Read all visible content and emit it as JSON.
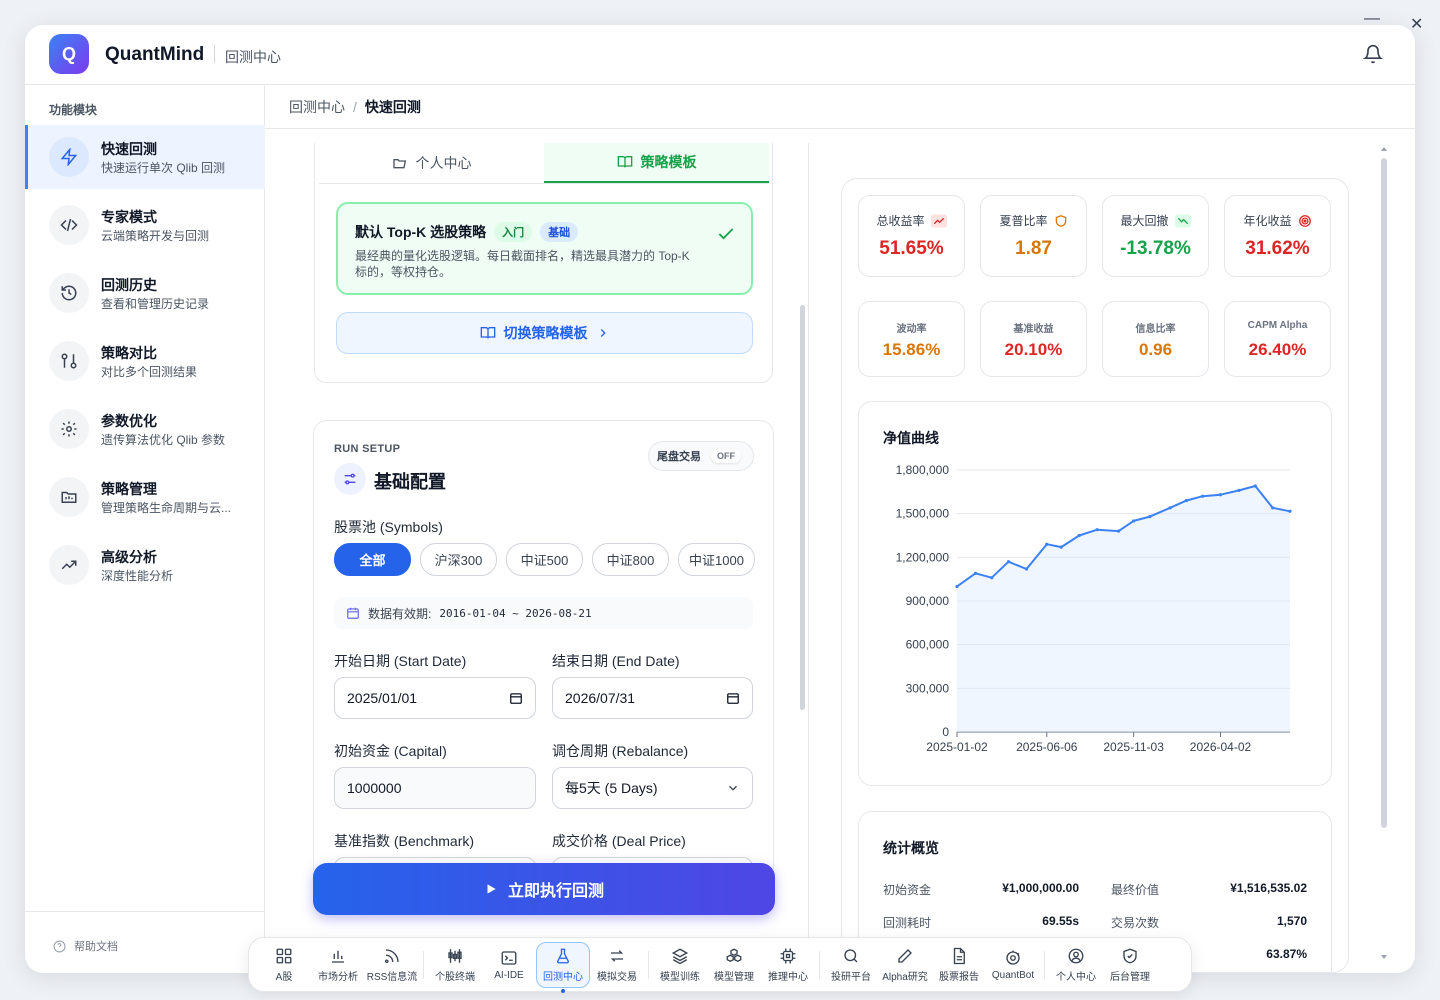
{
  "window": {
    "minimize": "—",
    "close": "✕"
  },
  "app": {
    "logo_letter": "Q",
    "name": "QuantMind",
    "section": "回测中心"
  },
  "sidebar": {
    "heading": "功能模块",
    "items": [
      {
        "title": "快速回测",
        "sub": "快速运行单次 Qlib 回测",
        "icon": "lightning-icon"
      },
      {
        "title": "专家模式",
        "sub": "云端策略开发与回测",
        "icon": "code-icon"
      },
      {
        "title": "回测历史",
        "sub": "查看和管理历史记录",
        "icon": "history-icon"
      },
      {
        "title": "策略对比",
        "sub": "对比多个回测结果",
        "icon": "compare-icon"
      },
      {
        "title": "参数优化",
        "sub": "遗传算法优化 Qlib 参数",
        "icon": "gear-icon"
      },
      {
        "title": "策略管理",
        "sub": "管理策略生命周期与云...",
        "icon": "folder-icon"
      },
      {
        "title": "高级分析",
        "sub": "深度性能分析",
        "icon": "trend-icon"
      }
    ],
    "help": "帮助文档"
  },
  "breadcrumb": {
    "parent": "回测中心",
    "sep": "/",
    "current": "快速回测"
  },
  "strategy_panel": {
    "tabs": [
      "个人中心",
      "策略模板"
    ],
    "active_tab": 1,
    "template": {
      "name": "默认 Top-K 选股策略",
      "badges": [
        "入门",
        "基础"
      ],
      "desc": "最经典的量化选股逻辑。每日截面排名，精选最具潜力的 Top-K 标的，等权持仓。"
    },
    "switch_label": "切换策略模板"
  },
  "config": {
    "run_label": "RUN SETUP",
    "title": "基础配置",
    "toggle_label": "尾盘交易",
    "toggle_state": "OFF",
    "pool_label": "股票池 (Symbols)",
    "pools": [
      "全部",
      "沪深300",
      "中证500",
      "中证800",
      "中证1000"
    ],
    "active_pool": 0,
    "validity_label": "数据有效期:",
    "validity_range": "2016-01-04 ~ 2026-08-21",
    "start_label": "开始日期 (Start Date)",
    "start_value": "2025/01/01",
    "end_label": "结束日期 (End Date)",
    "end_value": "2026/07/31",
    "capital_label": "初始资金 (Capital)",
    "capital_value": "1000000",
    "rebalance_label": "调仓周期 (Rebalance)",
    "rebalance_value": "每5天 (5 Days)",
    "benchmark_label": "基准指数 (Benchmark)",
    "deal_label": "成交价格 (Deal Price)"
  },
  "run_button": "立即执行回测",
  "metrics": [
    {
      "label": "总收益率",
      "value": "51.65%",
      "color": "#dc2626",
      "icon": "trend-up-icon"
    },
    {
      "label": "夏普比率",
      "value": "1.87",
      "color": "#d97706",
      "icon": "shield-icon"
    },
    {
      "label": "最大回撤",
      "value": "-13.78%",
      "color": "#16a34a",
      "icon": "trend-down-icon"
    },
    {
      "label": "年化收益",
      "value": "31.62%",
      "color": "#dc2626",
      "icon": "target-icon"
    },
    {
      "label": "波动率",
      "value": "15.86%",
      "color": "#d97706"
    },
    {
      "label": "基准收益",
      "value": "20.10%",
      "color": "#dc2626"
    },
    {
      "label": "信息比率",
      "value": "0.96",
      "color": "#d97706"
    },
    {
      "label": "CAPM Alpha",
      "value": "26.40%",
      "color": "#dc2626"
    }
  ],
  "chart_data": {
    "type": "area",
    "title": "净值曲线",
    "x": [
      "2025-01-02",
      "2025-02-03",
      "2025-03-03",
      "2025-04-01",
      "2025-05-02",
      "2025-06-06",
      "2025-07-01",
      "2025-08-01",
      "2025-09-01",
      "2025-10-08",
      "2025-11-03",
      "2025-12-01",
      "2026-01-05",
      "2026-02-02",
      "2026-03-02",
      "2026-04-02",
      "2026-05-04",
      "2026-06-01",
      "2026-07-01",
      "2026-07-31"
    ],
    "y": [
      1000000,
      1090000,
      1060000,
      1170000,
      1120000,
      1290000,
      1270000,
      1350000,
      1390000,
      1380000,
      1450000,
      1480000,
      1540000,
      1590000,
      1620000,
      1630000,
      1660000,
      1690000,
      1540000,
      1516535
    ],
    "xticks": [
      "2025-01-02",
      "2025-06-06",
      "2025-11-03",
      "2026-04-02"
    ],
    "yticks": [
      "0",
      "300,000",
      "600,000",
      "900,000",
      "1,200,000",
      "1,500,000",
      "1,800,000"
    ],
    "ylim": [
      0,
      1800000
    ],
    "grid": true,
    "color": "#3b82f6"
  },
  "stats": {
    "title": "统计概览",
    "rows": [
      {
        "k1": "初始资金",
        "v1": "¥1,000,000.00",
        "k2": "最终价值",
        "v2": "¥1,516,535.02"
      },
      {
        "k1": "回测耗时",
        "v1": "69.55s",
        "k2": "交易次数",
        "v2": "1,570"
      },
      {
        "k1": "",
        "v1": "",
        "k2": "",
        "v2": "63.87%"
      }
    ]
  },
  "dock": [
    {
      "label": "A股",
      "icon": "grid-icon"
    },
    {
      "label": "市场分析",
      "icon": "bar-chart-icon"
    },
    {
      "label": "RSS信息流",
      "icon": "rss-icon"
    },
    {
      "label": "个股终端",
      "icon": "candles-icon"
    },
    {
      "label": "AI-IDE",
      "icon": "terminal-icon"
    },
    {
      "label": "回测中心",
      "icon": "flask-icon"
    },
    {
      "label": "模拟交易",
      "icon": "swap-icon"
    },
    {
      "label": "模型训练",
      "icon": "layers-icon"
    },
    {
      "label": "模型管理",
      "icon": "boxes-icon"
    },
    {
      "label": "推理中心",
      "icon": "chip-icon"
    },
    {
      "label": "投研平台",
      "icon": "search-icon"
    },
    {
      "label": "Alpha研究",
      "icon": "pen-icon"
    },
    {
      "label": "股票报告",
      "icon": "doc-icon"
    },
    {
      "label": "QuantBot",
      "icon": "bot-icon"
    },
    {
      "label": "个人中心",
      "icon": "user-icon"
    },
    {
      "label": "后台管理",
      "icon": "shield-check-icon"
    }
  ],
  "active_dock": 5
}
